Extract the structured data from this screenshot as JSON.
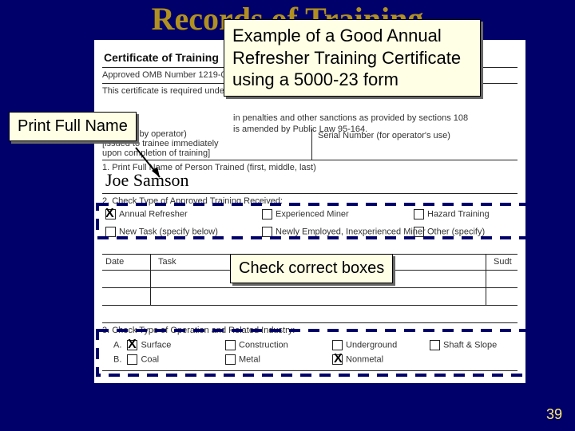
{
  "title": "Records of Training",
  "callouts": {
    "intro_l1": "Example of a Good Annual",
    "intro_l2": "Refresher Training Certificate",
    "intro_l3": "using a 5000-23 form",
    "print_name": "Print Full Name",
    "check_boxes": "Check correct boxes"
  },
  "form": {
    "heading": "Certificate of Training",
    "omb": "Approved OMB Number 1219-0070, Expires",
    "pl_line": "This certificate is required under Public",
    "penalty_l1": "in penalties and other sanctions as provided by sections 108",
    "penalty_l2": "is amended by Public Law 95-164.",
    "ret1": "(retained by operator)",
    "ret2": "[issued to trainee immediately",
    "ret3": "upon completion of training]",
    "serial": "Serial Number (for operator's use)",
    "section1": "1. Print Full Name of Person Trained (first, middle, last)",
    "trainee_name": "Joe Samson",
    "section2": "2. Check Type of Approved Training Received:",
    "opts2": {
      "annual": "Annual Refresher",
      "newtask": "New Task (specify below)",
      "exp": "Experienced Miner",
      "newemp": "Newly Employed, Inexperienced Miner",
      "hazard": "Hazard Training",
      "other": "Other (specify)"
    },
    "cols": {
      "date": "Date",
      "task": "Task",
      "sudt": "Sudt"
    },
    "section3": "3. Check Type of Operation and Related Industry:",
    "opts3": {
      "a": "A.",
      "surface": "Surface",
      "construction": "Construction",
      "underground": "Underground",
      "shaft": "Shaft & Slope",
      "b": "B.",
      "coal": "Coal",
      "metal": "Metal",
      "nonmetal": "Nonmetal"
    }
  },
  "page_number": "39"
}
